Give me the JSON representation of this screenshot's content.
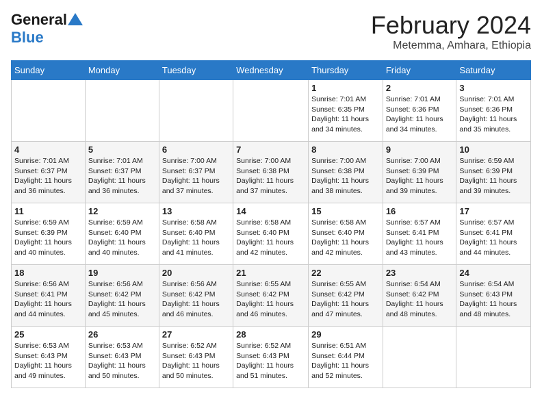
{
  "logo": {
    "line1": "General",
    "line2": "Blue",
    "triangle": true
  },
  "title": "February 2024",
  "subtitle": "Metemma, Amhara, Ethiopia",
  "days_header": [
    "Sunday",
    "Monday",
    "Tuesday",
    "Wednesday",
    "Thursday",
    "Friday",
    "Saturday"
  ],
  "weeks": [
    [
      {
        "day": "",
        "info": ""
      },
      {
        "day": "",
        "info": ""
      },
      {
        "day": "",
        "info": ""
      },
      {
        "day": "",
        "info": ""
      },
      {
        "day": "1",
        "info": "Sunrise: 7:01 AM\nSunset: 6:35 PM\nDaylight: 11 hours\nand 34 minutes."
      },
      {
        "day": "2",
        "info": "Sunrise: 7:01 AM\nSunset: 6:36 PM\nDaylight: 11 hours\nand 34 minutes."
      },
      {
        "day": "3",
        "info": "Sunrise: 7:01 AM\nSunset: 6:36 PM\nDaylight: 11 hours\nand 35 minutes."
      }
    ],
    [
      {
        "day": "4",
        "info": "Sunrise: 7:01 AM\nSunset: 6:37 PM\nDaylight: 11 hours\nand 36 minutes."
      },
      {
        "day": "5",
        "info": "Sunrise: 7:01 AM\nSunset: 6:37 PM\nDaylight: 11 hours\nand 36 minutes."
      },
      {
        "day": "6",
        "info": "Sunrise: 7:00 AM\nSunset: 6:37 PM\nDaylight: 11 hours\nand 37 minutes."
      },
      {
        "day": "7",
        "info": "Sunrise: 7:00 AM\nSunset: 6:38 PM\nDaylight: 11 hours\nand 37 minutes."
      },
      {
        "day": "8",
        "info": "Sunrise: 7:00 AM\nSunset: 6:38 PM\nDaylight: 11 hours\nand 38 minutes."
      },
      {
        "day": "9",
        "info": "Sunrise: 7:00 AM\nSunset: 6:39 PM\nDaylight: 11 hours\nand 39 minutes."
      },
      {
        "day": "10",
        "info": "Sunrise: 6:59 AM\nSunset: 6:39 PM\nDaylight: 11 hours\nand 39 minutes."
      }
    ],
    [
      {
        "day": "11",
        "info": "Sunrise: 6:59 AM\nSunset: 6:39 PM\nDaylight: 11 hours\nand 40 minutes."
      },
      {
        "day": "12",
        "info": "Sunrise: 6:59 AM\nSunset: 6:40 PM\nDaylight: 11 hours\nand 40 minutes."
      },
      {
        "day": "13",
        "info": "Sunrise: 6:58 AM\nSunset: 6:40 PM\nDaylight: 11 hours\nand 41 minutes."
      },
      {
        "day": "14",
        "info": "Sunrise: 6:58 AM\nSunset: 6:40 PM\nDaylight: 11 hours\nand 42 minutes."
      },
      {
        "day": "15",
        "info": "Sunrise: 6:58 AM\nSunset: 6:40 PM\nDaylight: 11 hours\nand 42 minutes."
      },
      {
        "day": "16",
        "info": "Sunrise: 6:57 AM\nSunset: 6:41 PM\nDaylight: 11 hours\nand 43 minutes."
      },
      {
        "day": "17",
        "info": "Sunrise: 6:57 AM\nSunset: 6:41 PM\nDaylight: 11 hours\nand 44 minutes."
      }
    ],
    [
      {
        "day": "18",
        "info": "Sunrise: 6:56 AM\nSunset: 6:41 PM\nDaylight: 11 hours\nand 44 minutes."
      },
      {
        "day": "19",
        "info": "Sunrise: 6:56 AM\nSunset: 6:42 PM\nDaylight: 11 hours\nand 45 minutes."
      },
      {
        "day": "20",
        "info": "Sunrise: 6:56 AM\nSunset: 6:42 PM\nDaylight: 11 hours\nand 46 minutes."
      },
      {
        "day": "21",
        "info": "Sunrise: 6:55 AM\nSunset: 6:42 PM\nDaylight: 11 hours\nand 46 minutes."
      },
      {
        "day": "22",
        "info": "Sunrise: 6:55 AM\nSunset: 6:42 PM\nDaylight: 11 hours\nand 47 minutes."
      },
      {
        "day": "23",
        "info": "Sunrise: 6:54 AM\nSunset: 6:42 PM\nDaylight: 11 hours\nand 48 minutes."
      },
      {
        "day": "24",
        "info": "Sunrise: 6:54 AM\nSunset: 6:43 PM\nDaylight: 11 hours\nand 48 minutes."
      }
    ],
    [
      {
        "day": "25",
        "info": "Sunrise: 6:53 AM\nSunset: 6:43 PM\nDaylight: 11 hours\nand 49 minutes."
      },
      {
        "day": "26",
        "info": "Sunrise: 6:53 AM\nSunset: 6:43 PM\nDaylight: 11 hours\nand 50 minutes."
      },
      {
        "day": "27",
        "info": "Sunrise: 6:52 AM\nSunset: 6:43 PM\nDaylight: 11 hours\nand 50 minutes."
      },
      {
        "day": "28",
        "info": "Sunrise: 6:52 AM\nSunset: 6:43 PM\nDaylight: 11 hours\nand 51 minutes."
      },
      {
        "day": "29",
        "info": "Sunrise: 6:51 AM\nSunset: 6:44 PM\nDaylight: 11 hours\nand 52 minutes."
      },
      {
        "day": "",
        "info": ""
      },
      {
        "day": "",
        "info": ""
      }
    ]
  ]
}
